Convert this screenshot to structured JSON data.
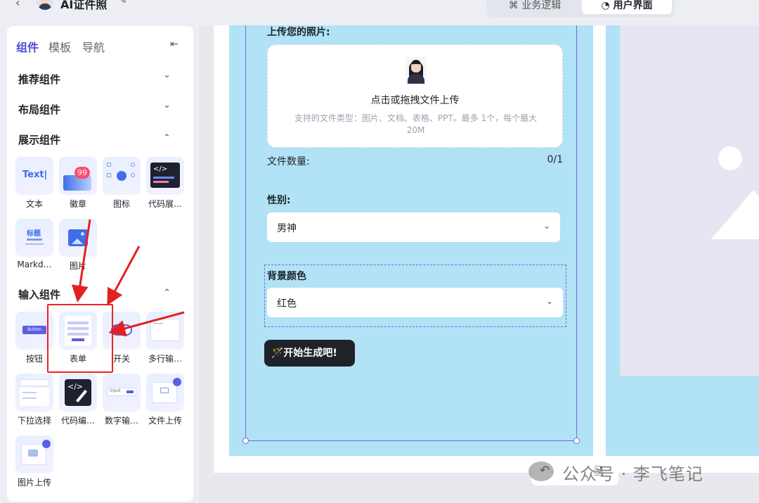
{
  "header": {
    "title": "AI证件照",
    "back_icon": "‹",
    "edit_icon": "✎",
    "view_tabs": [
      {
        "icon": "⌘",
        "label": "业务逻辑"
      },
      {
        "icon": "◔",
        "label": "用户界面"
      }
    ]
  },
  "sidebar": {
    "tabs": [
      "组件",
      "模板",
      "导航"
    ],
    "collapse_icon": "⇤",
    "sections": [
      "推荐组件",
      "布局组件",
      "展示组件",
      "输入组件"
    ],
    "chevron_down": "⌄",
    "chevron_up": "⌃",
    "display_components": [
      {
        "label": "文本",
        "tile_text": "Text|"
      },
      {
        "label": "徽章",
        "badge": "99"
      },
      {
        "label": "图标"
      },
      {
        "label": "代码展…",
        "tile_text": "</>"
      },
      {
        "label": "Markd…",
        "tile_text": "标题"
      },
      {
        "label": "图片"
      }
    ],
    "input_components": [
      {
        "label": "按钮",
        "tile_text": "Button"
      },
      {
        "label": "表单"
      },
      {
        "label": "开关"
      },
      {
        "label": "多行输…"
      },
      {
        "label": "下拉选择"
      },
      {
        "label": "代码编…",
        "tile_text": "</>"
      },
      {
        "label": "数字输…",
        "tile_text": "input"
      },
      {
        "label": "文件上传"
      },
      {
        "label": "图片上传"
      }
    ]
  },
  "form": {
    "upload_label": "上传您的照片:",
    "upload_title": "点击或拖拽文件上传",
    "upload_hint": "支持的文件类型：图片、文档、表格、PPT。最多 1个，每个最大 20M",
    "file_count_label": "文件数量:",
    "file_count_value": "0/1",
    "gender_label": "性别:",
    "gender_value": "男神",
    "bg_color_label": "背景颜色",
    "bg_color_value": "红色",
    "submit_label": "🪄开始生成吧!"
  },
  "toolbar": {
    "undo_icon": "↶",
    "save_icon": "🗎"
  },
  "watermark": {
    "text": "公众号 · 李飞笔记"
  },
  "colors": {
    "accent": "#4e4ad9",
    "phone_bg": "#b1e2f6",
    "annotation": "#e22222"
  }
}
